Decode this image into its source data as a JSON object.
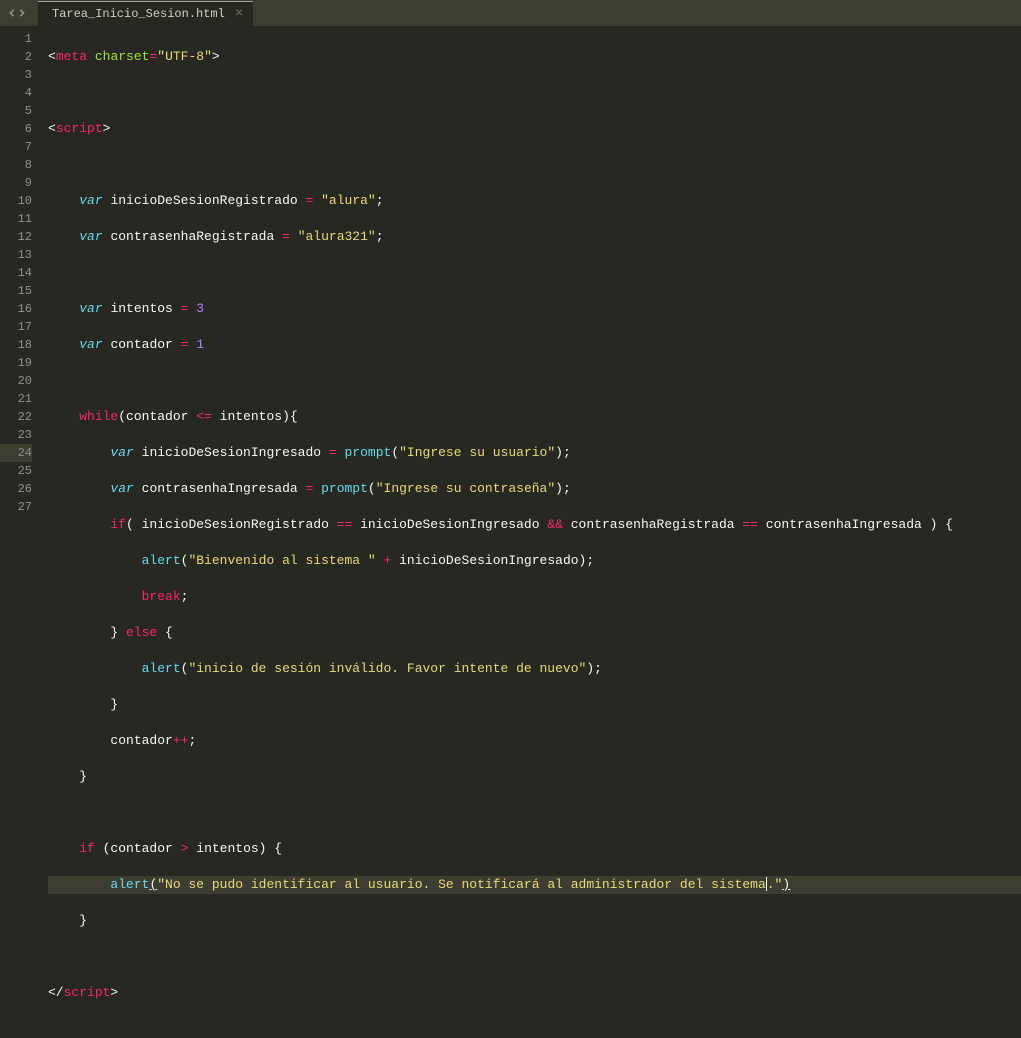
{
  "tab": {
    "filename": "Tarea_Inicio_Sesion.html",
    "close": "×"
  },
  "lineCount": 27,
  "activeLine": 24,
  "code": {
    "l1": {
      "t1": "<",
      "t2": "meta",
      "sp1": " ",
      "t3": "charset",
      "t4": "=",
      "t5": "\"UTF-8\"",
      "t6": ">"
    },
    "l3": {
      "t1": "<",
      "t2": "script",
      "t3": ">"
    },
    "l5": {
      "ind": "    ",
      "kw": "var",
      "sp": " ",
      "id": "inicioDeSesionRegistrado ",
      "op": "=",
      "sp2": " ",
      "str": "\"alura\"",
      "sc": ";"
    },
    "l6": {
      "ind": "    ",
      "kw": "var",
      "sp": " ",
      "id": "contrasenhaRegistrada ",
      "op": "=",
      "sp2": " ",
      "str": "\"alura321\"",
      "sc": ";"
    },
    "l8": {
      "ind": "    ",
      "kw": "var",
      "sp": " ",
      "id": "intentos ",
      "op": "=",
      "sp2": " ",
      "num": "3"
    },
    "l9": {
      "ind": "    ",
      "kw": "var",
      "sp": " ",
      "id": "contador ",
      "op": "=",
      "sp2": " ",
      "num": "1"
    },
    "l11": {
      "ind": "    ",
      "kw": "while",
      "p1": "(contador ",
      "op": "<=",
      "p2": " intentos){"
    },
    "l12": {
      "ind": "        ",
      "kw": "var",
      "sp": " ",
      "id": "inicioDeSesionIngresado ",
      "op": "=",
      "sp2": " ",
      "fn": "prompt",
      "p1": "(",
      "str": "\"Ingrese su usuario\"",
      "p2": ");"
    },
    "l13": {
      "ind": "        ",
      "kw": "var",
      "sp": " ",
      "id": "contrasenhaIngresada ",
      "op": "=",
      "sp2": " ",
      "fn": "prompt",
      "p1": "(",
      "str": "\"Ingrese su contraseña\"",
      "p2": ");"
    },
    "l14": {
      "ind": "        ",
      "kw": "if",
      "p1": "( inicioDeSesionRegistrado ",
      "op1": "==",
      "p2": " inicioDeSesionIngresado ",
      "op2": "&&",
      "p3": " contrasenhaRegistrada ",
      "op3": "==",
      "p4": " contrasenhaIngresada ) {"
    },
    "l15": {
      "ind": "            ",
      "fn": "alert",
      "p1": "(",
      "str": "\"Bienvenido al sistema \"",
      "sp": " ",
      "op": "+",
      "sp2": " inicioDeSesionIngresado);"
    },
    "l16": {
      "ind": "            ",
      "kw": "break",
      "sc": ";"
    },
    "l17": {
      "ind": "        ",
      "p": "} ",
      "kw": "else",
      "p2": " {"
    },
    "l18": {
      "ind": "            ",
      "fn": "alert",
      "p1": "(",
      "str": "\"inicio de sesión inválido. Favor intente de nuevo\"",
      "p2": ");"
    },
    "l19": {
      "ind": "        ",
      "p": "}"
    },
    "l20": {
      "ind": "        ",
      "id": "contador",
      "op": "++",
      "sc": ";"
    },
    "l21": {
      "ind": "    ",
      "p": "}"
    },
    "l23": {
      "ind": "    ",
      "kw": "if",
      "p1": " (contador ",
      "op": ">",
      "p2": " intentos) {"
    },
    "l24": {
      "ind": "        ",
      "fn": "alert",
      "p1": "(",
      "str1": "\"No se pudo identificar al usuario. Se notificará al administrador del sistema",
      "str2": ".\"",
      "p2": ")"
    },
    "l25": {
      "ind": "    ",
      "p": "}"
    },
    "l27": {
      "t1": "</",
      "t2": "script",
      "t3": ">"
    }
  }
}
